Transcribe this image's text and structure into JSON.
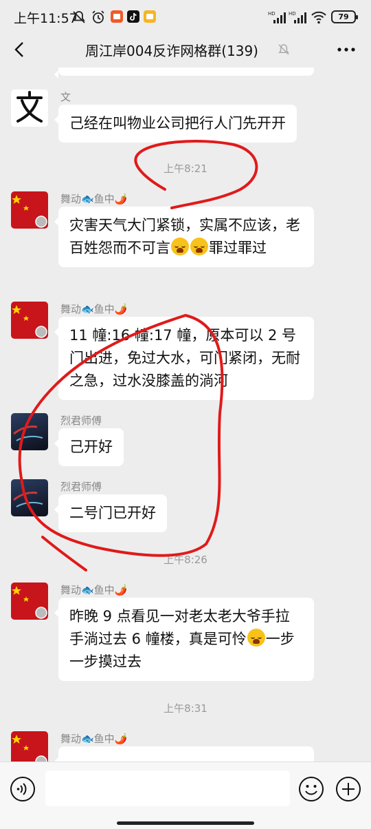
{
  "status_bar": {
    "time": "上午11:57",
    "battery": "79"
  },
  "header": {
    "title": "周江岸004反诈网格群(139)"
  },
  "messages": [
    {
      "sender": "文",
      "text": "己经在叫物业公司把行人门先开开"
    },
    {
      "time": "上午8:21"
    },
    {
      "sender": "舞动🐟鱼中🌶️",
      "text_a": "灾害天气大门紧锁，实属不应该，老百姓怨而不可言",
      "text_b": "罪过罪过"
    },
    {
      "sender": "舞动🐟鱼中🌶️",
      "text": "11 幢:16 幢:17 幢，原本可以 2 号门出进，免过大水，可门紧闭，无耐之急，过水没膝盖的淌河"
    },
    {
      "sender": "烈君师傅",
      "text": "己开好"
    },
    {
      "sender": "烈君师傅",
      "text": "二号门已开好"
    },
    {
      "time": "上午8:26"
    },
    {
      "sender": "舞动🐟鱼中🌶️",
      "text_a": "昨晚 9 点看见一对老太老大爷手拉手淌过去 6 幢楼，真是可怜",
      "text_b": "一步一步摸过去"
    },
    {
      "time": "上午8:31"
    },
    {
      "sender": "舞动🐟鱼中🌶️"
    }
  ],
  "icons": {
    "back": "back-arrow-icon",
    "mute": "bell-mute-icon",
    "more": "more-dots-icon",
    "voice": "voice-icon",
    "emoji": "emoji-icon",
    "plus": "plus-icon"
  },
  "colors": {
    "background": "#ededed",
    "bubble": "#ffffff",
    "annotation": "#e01a1a"
  }
}
